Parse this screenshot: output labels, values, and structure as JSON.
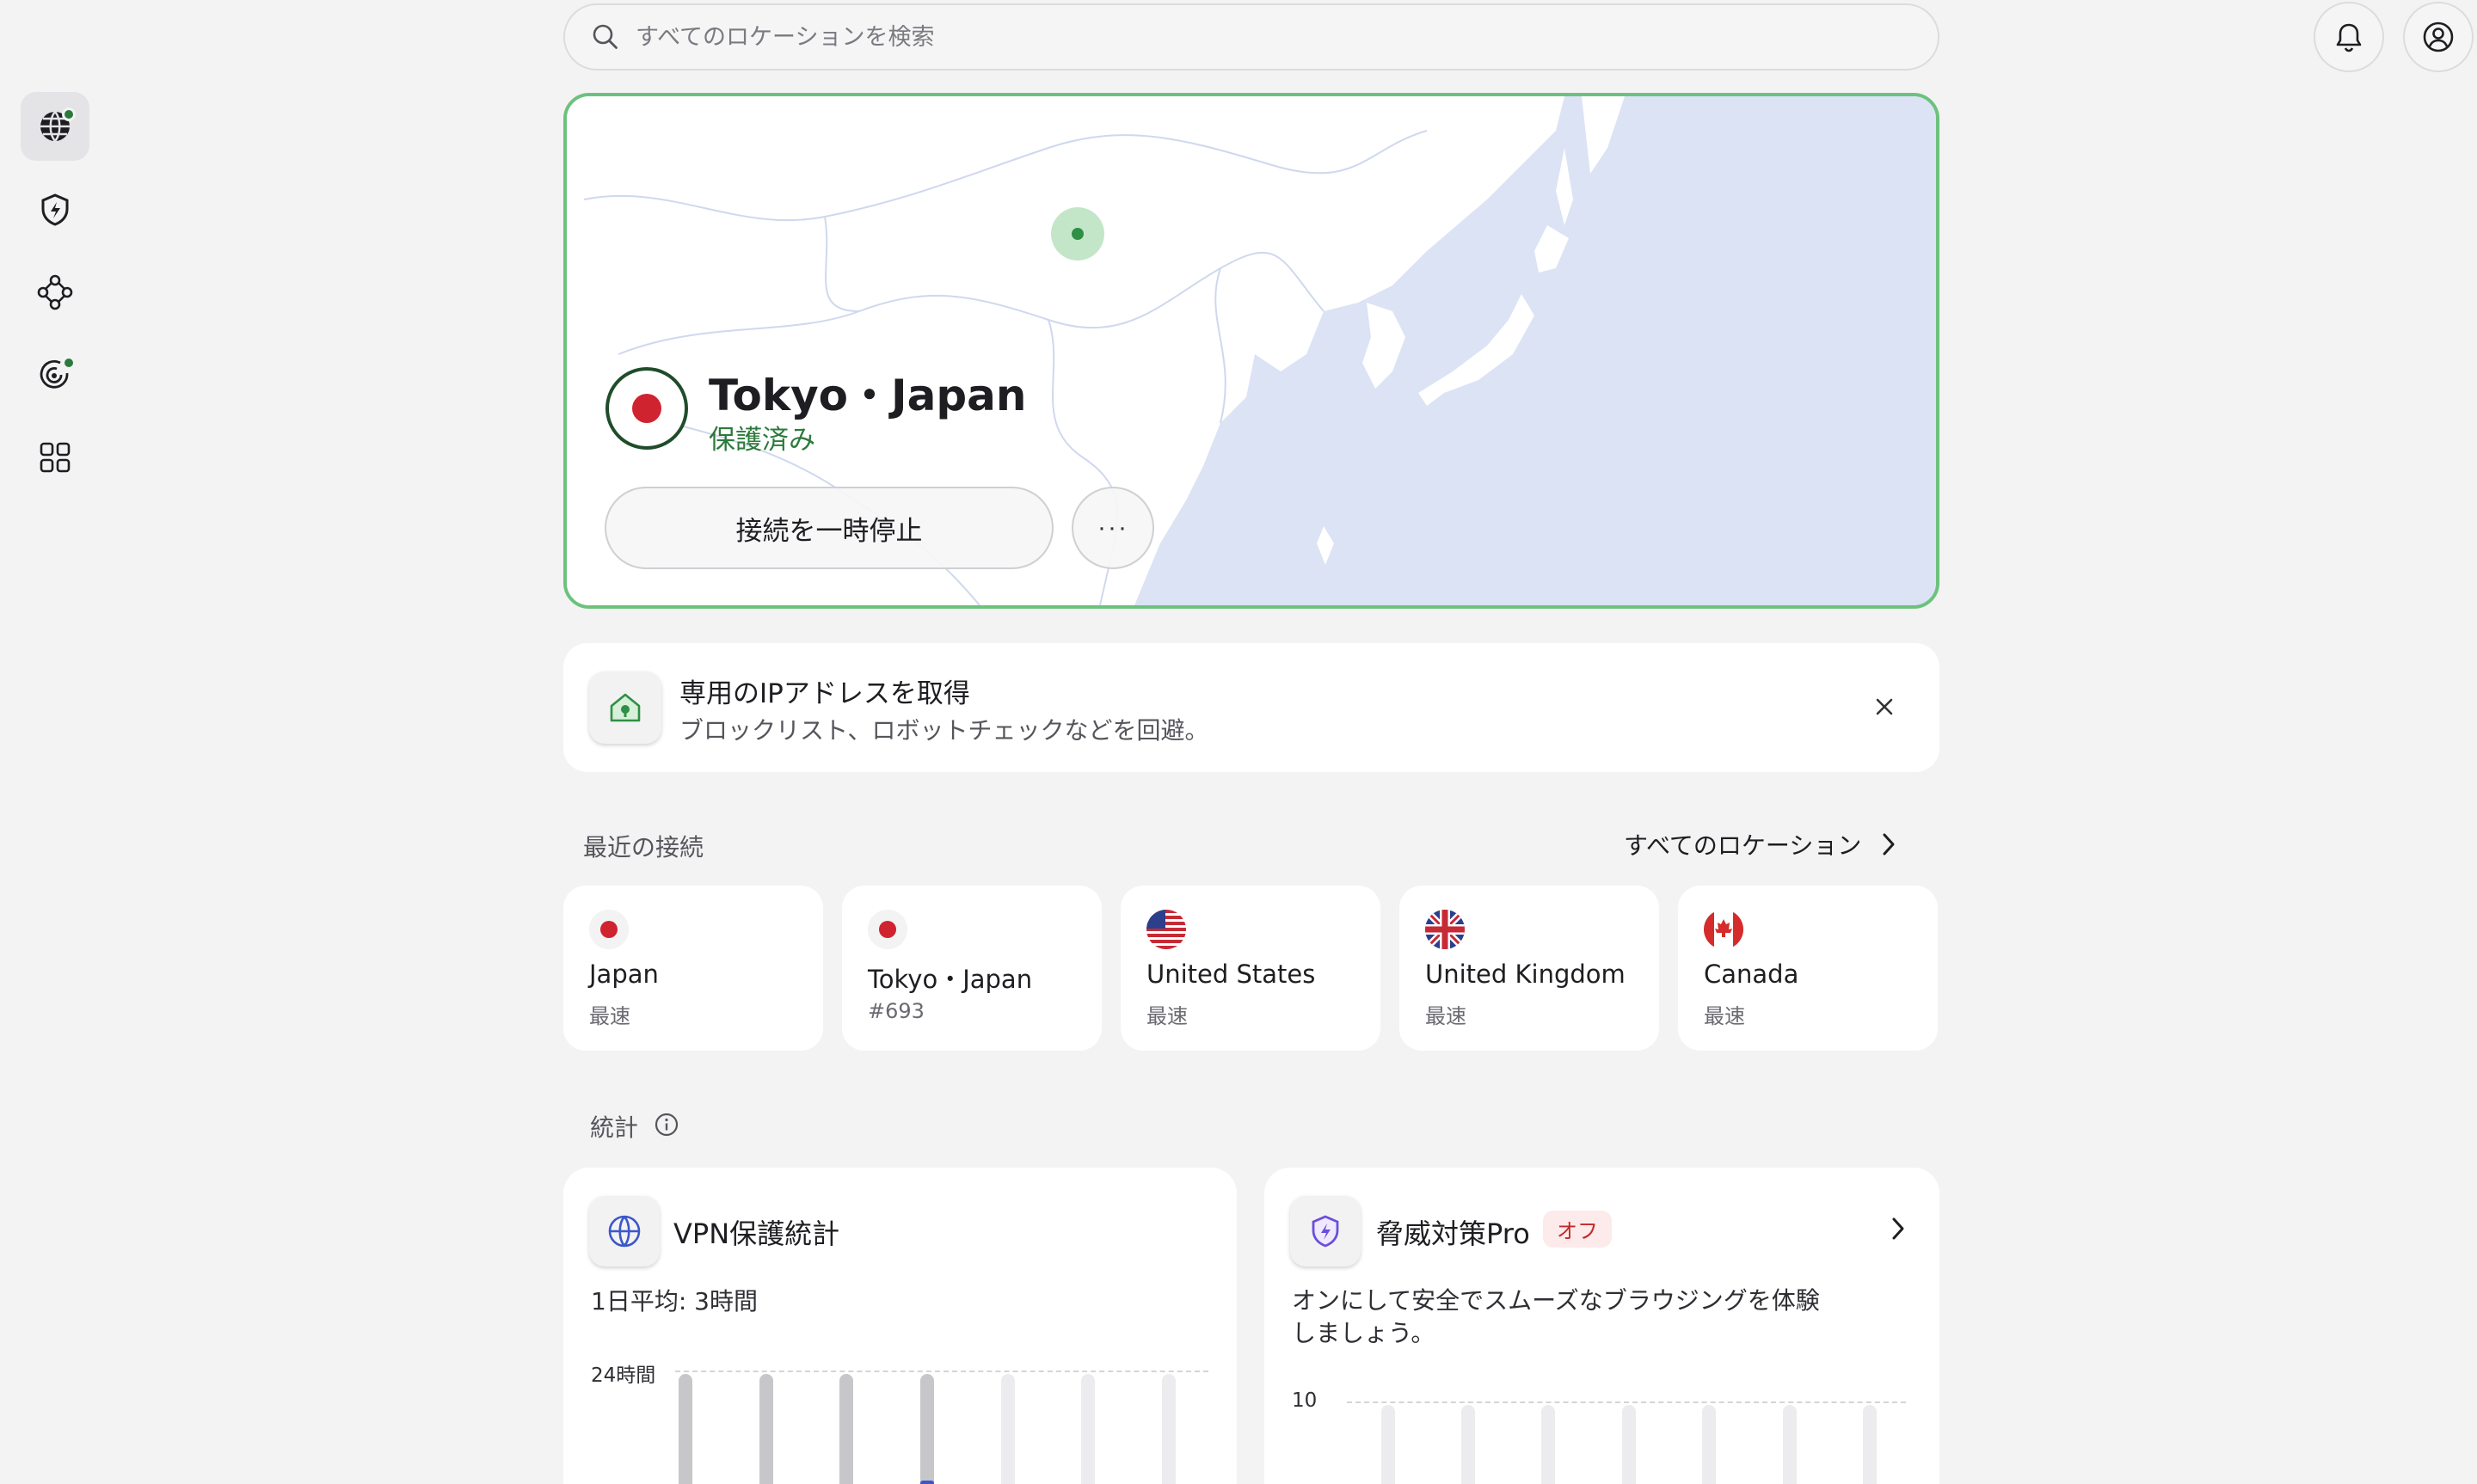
{
  "search": {
    "placeholder": "すべてのロケーションを検索"
  },
  "sidebar": {
    "items": [
      {
        "icon": "globe-icon",
        "active": true,
        "badge": true
      },
      {
        "icon": "shield-bolt-icon",
        "active": false,
        "badge": false
      },
      {
        "icon": "mesh-network-icon",
        "active": false,
        "badge": false
      },
      {
        "icon": "radar-icon",
        "active": false,
        "badge": true
      },
      {
        "icon": "apps-grid-icon",
        "active": false,
        "badge": false
      }
    ]
  },
  "header": {
    "notifications_icon": "bell-icon",
    "account_icon": "user-circle-icon"
  },
  "connection": {
    "location": "Tokyo・Japan",
    "status": "保護済み",
    "pause_label": "接続を一時停止",
    "more_label": "···",
    "accent_color": "#6cc27c",
    "status_color": "#2b7a3a"
  },
  "promo": {
    "title": "専用のIPアドレスを取得",
    "subtitle": "ブロックリスト、ロボットチェックなどを回避。"
  },
  "recent": {
    "label": "最近の接続",
    "all_locations_label": "すべてのロケーション",
    "items": [
      {
        "name": "Japan",
        "sub": "最速",
        "flag": "jp"
      },
      {
        "name": "Tokyo・Japan",
        "sub": "#693",
        "flag": "jp"
      },
      {
        "name": "United States",
        "sub": "最速",
        "flag": "us"
      },
      {
        "name": "United Kingdom",
        "sub": "最速",
        "flag": "uk"
      },
      {
        "name": "Canada",
        "sub": "最速",
        "flag": "ca"
      }
    ]
  },
  "stats": {
    "label": "統計",
    "vpn": {
      "title": "VPN保護統計",
      "daily_avg": "1日平均: 3時間",
      "y_max_label": "24時間"
    },
    "threat": {
      "title": "脅威対策Pro",
      "badge": "オフ",
      "description": "オンにして安全でスムーズなブラウジングを体験しましょう。",
      "y_max_label": "10"
    }
  }
}
